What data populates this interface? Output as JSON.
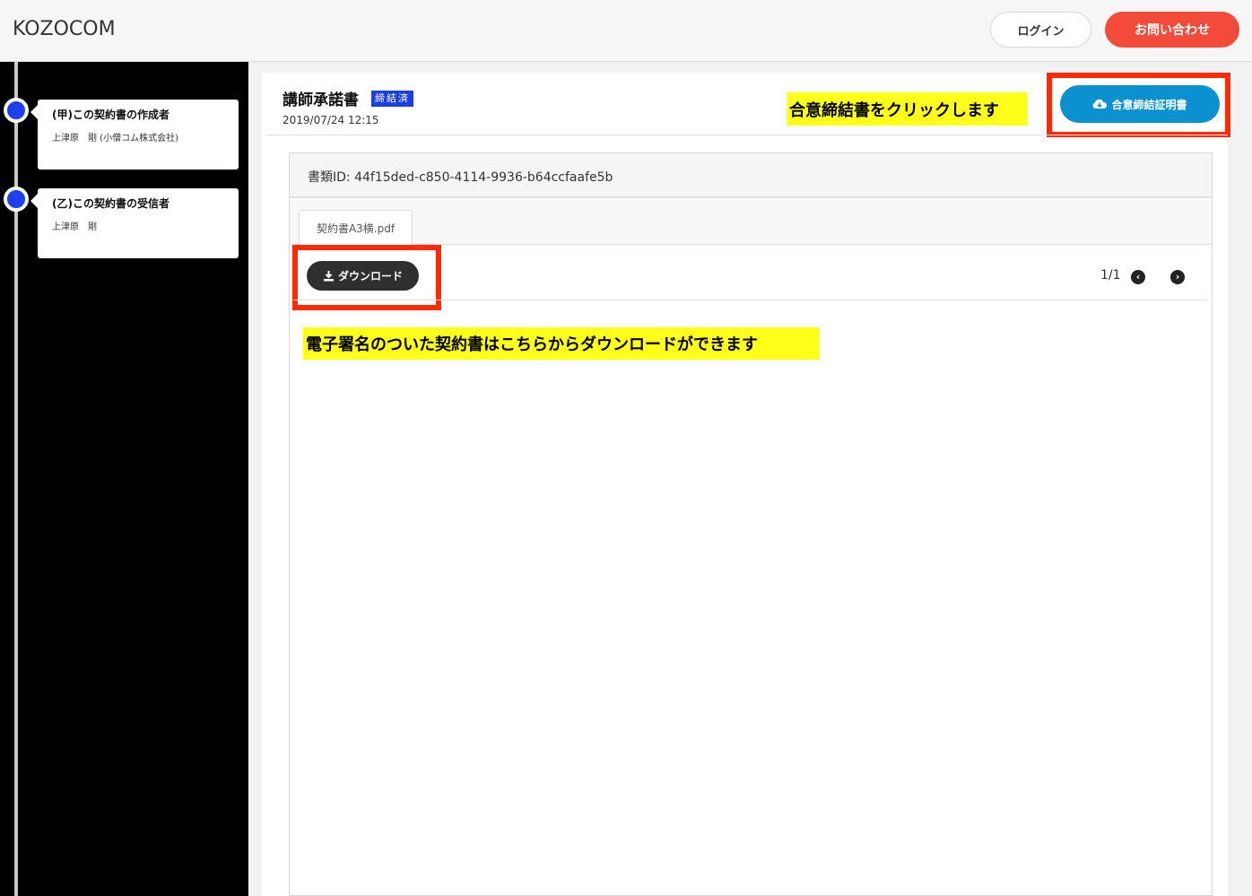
{
  "header": {
    "logo": "KOZOCOM",
    "login_label": "ログイン",
    "contact_label": "お問い合わせ",
    "contact_color": "#f24b3a"
  },
  "sidebar": {
    "parties": [
      {
        "title": "(甲)この契約書の作成者",
        "name": "上津原　剛 (小僧コム株式会社)"
      },
      {
        "title": "(乙)この契約書の受信者",
        "name": "上津原　剛"
      }
    ],
    "dot_color": "#1d3ff0"
  },
  "document": {
    "title": "講師承諾書",
    "status_badge": "締結済",
    "date": "2019/07/24 12:15",
    "annotation_top": "合意締結書をクリックします",
    "certificate_button": "合意締結証明書",
    "certificate_icon": "cloud-download-icon",
    "doc_id_label": "書類ID: 44f15ded-c850-4114-9936-b64ccfaafe5b",
    "tab_file": "契約書A3横.pdf",
    "download_button": "ダウンロード",
    "download_icon": "download-icon",
    "page_indicator": "1/1",
    "prev_icon": "arrow-left-icon",
    "next_icon": "arrow-right-icon",
    "annotation_bottom": "電子署名のついた契約書はこちらからダウンロードができます",
    "highlight_color": "#ffff1a",
    "callout_box_color": "#ff2a00",
    "certificate_button_color": "#0b90d0"
  }
}
